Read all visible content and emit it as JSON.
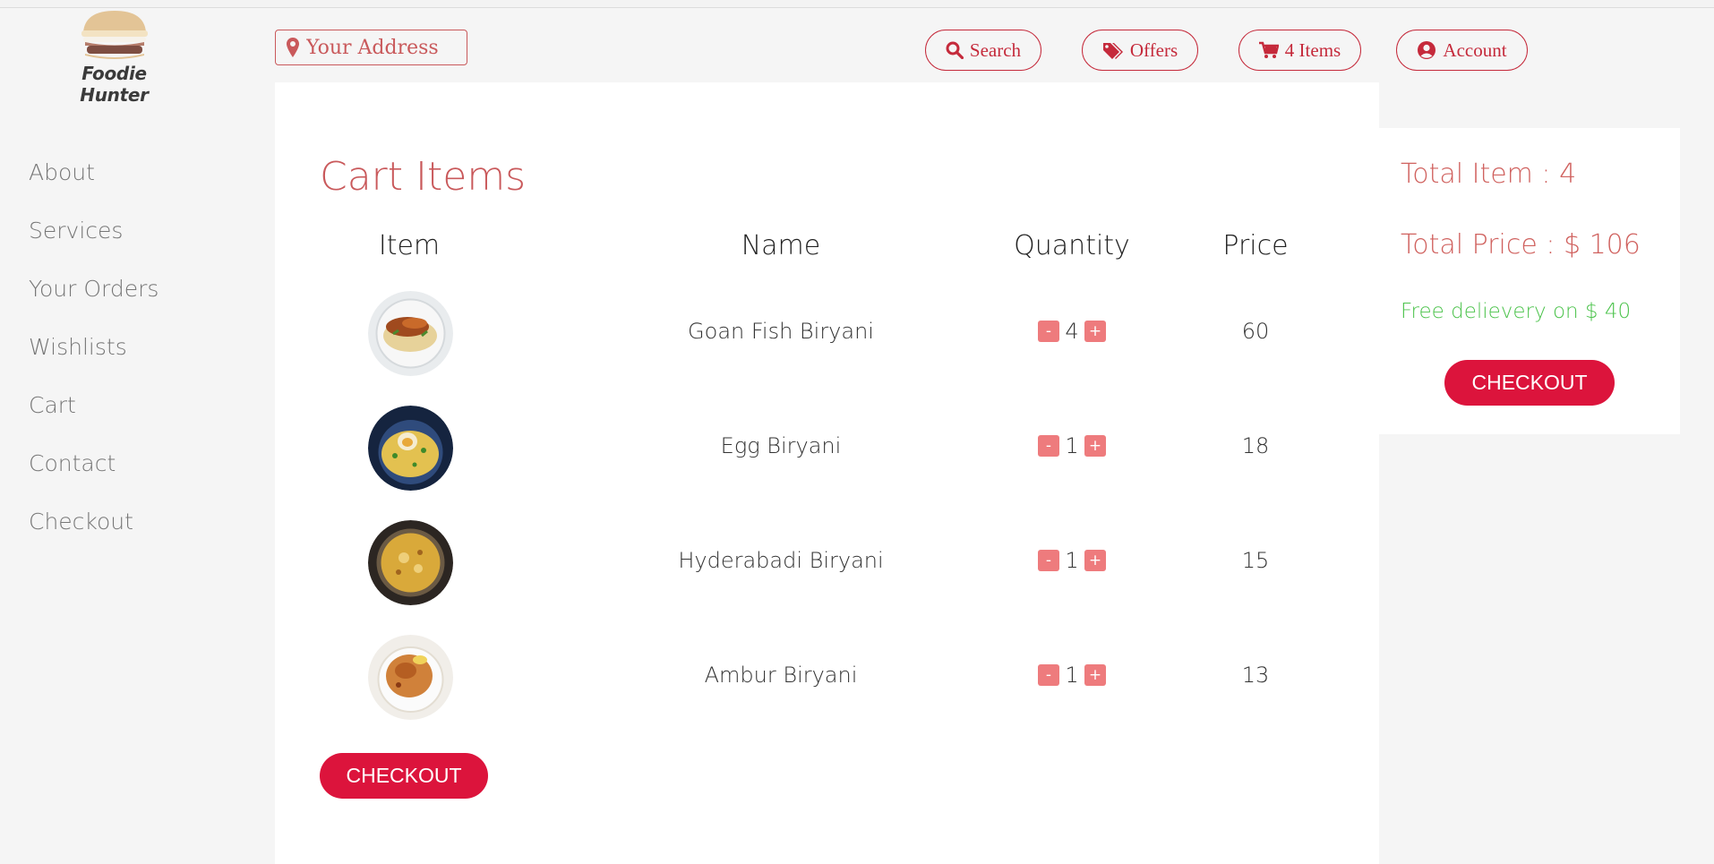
{
  "brand": {
    "name": "Foodie Hunter"
  },
  "header": {
    "address_placeholder": "Your Address",
    "search_label": "Search",
    "offers_label": "Offers",
    "items_label": "4 Items",
    "account_label": "Account"
  },
  "sidebar": {
    "items": [
      {
        "label": "About"
      },
      {
        "label": "Services"
      },
      {
        "label": "Your Orders"
      },
      {
        "label": "Wishlists"
      },
      {
        "label": "Cart"
      },
      {
        "label": "Contact"
      },
      {
        "label": "Checkout"
      }
    ]
  },
  "cart": {
    "title": "Cart Items",
    "columns": {
      "item": "Item",
      "name": "Name",
      "quantity": "Quantity",
      "price": "Price"
    },
    "rows": [
      {
        "name": "Goan Fish Biryani",
        "qty": "4",
        "price": "60"
      },
      {
        "name": "Egg Biryani",
        "qty": "1",
        "price": "18"
      },
      {
        "name": "Hyderabadi Biryani",
        "qty": "1",
        "price": "15"
      },
      {
        "name": "Ambur Biryani",
        "qty": "1",
        "price": "13"
      }
    ],
    "minus": "-",
    "plus": "+",
    "checkout_label": "CHECKOUT"
  },
  "summary": {
    "total_items": "Total Item : 4",
    "total_price": "Total Price : $ 106",
    "free_delivery": "Free delievery on $ 40",
    "checkout_label": "CHECKOUT"
  },
  "colors": {
    "accent": "#dc143c",
    "title": "#c9595b",
    "free_delivery": "#4cc34c",
    "qty_button": "#ee7b7d"
  },
  "icons": {
    "address": "map-pin-icon",
    "search": "search-icon",
    "offers": "tags-icon",
    "cart": "cart-icon",
    "account": "user-circle-icon"
  }
}
